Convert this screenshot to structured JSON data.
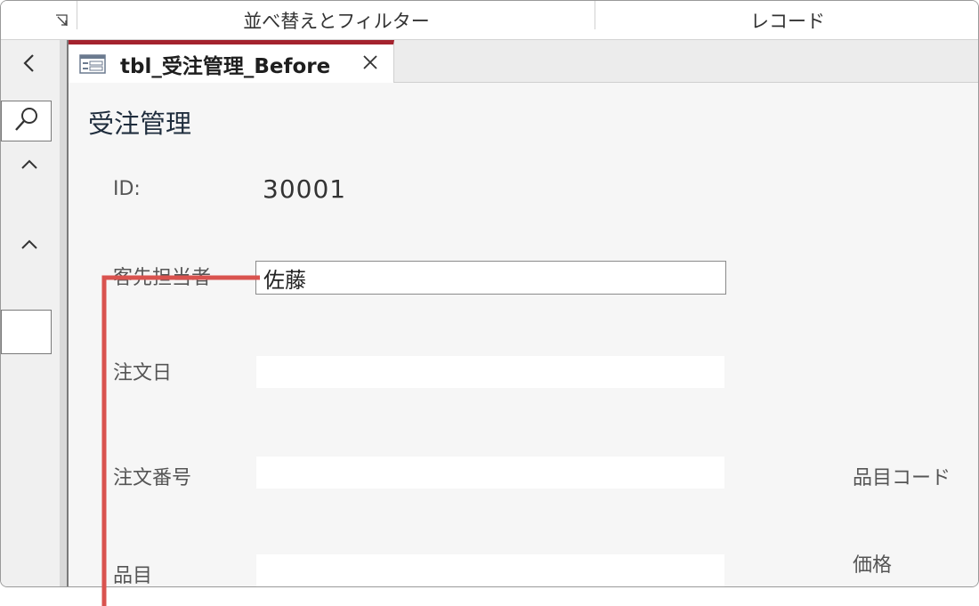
{
  "ribbon": {
    "groups": [
      "並べ替えとフィルター",
      "レコード"
    ]
  },
  "tab": {
    "label": "tbl_受注管理_Before"
  },
  "form": {
    "title": "受注管理",
    "fields": {
      "id": {
        "label": "ID:",
        "value": "30001"
      },
      "client_rep": {
        "label": "客先担当者",
        "value": "佐藤"
      },
      "order_date": {
        "label": "注文日",
        "value": ""
      },
      "order_number": {
        "label": "注文番号",
        "value": ""
      },
      "item": {
        "label": "品目",
        "value": ""
      },
      "item_code": {
        "label": "品目コード"
      },
      "price": {
        "label": "価格"
      }
    }
  },
  "colors": {
    "tab_accent": "#a4232e",
    "callout": "#d9534f"
  },
  "icons": {
    "ribbon_launcher": "dialog-launcher-icon",
    "tab": "form-icon",
    "close": "close-icon",
    "collapse": "chevron-left-icon",
    "search": "search-icon",
    "section": "chevron-up-icon"
  }
}
